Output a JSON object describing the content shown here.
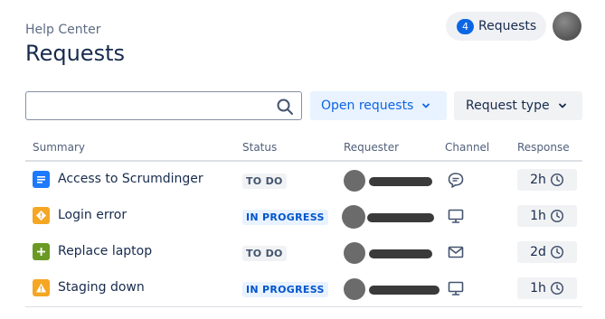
{
  "header": {
    "breadcrumb": "Help Center",
    "title": "Requests",
    "requests_count": "4",
    "requests_label": "Requests"
  },
  "search": {
    "value": "",
    "placeholder": ""
  },
  "filters": {
    "open_requests": "Open requests",
    "request_type": "Request type"
  },
  "table": {
    "columns": [
      "Summary",
      "Status",
      "Requester",
      "Channel",
      "Response"
    ],
    "rows": [
      {
        "summary": "Access to Scrumdinger",
        "status": "TO DO",
        "status_kind": "todo",
        "type_icon": "service-request-icon",
        "type_color": "#1d7afc",
        "channel": "chat-icon",
        "response": "2h"
      },
      {
        "summary": "Login error",
        "status": "IN PROGRESS",
        "status_kind": "progress",
        "type_icon": "incident-icon",
        "type_color": "#f5a623",
        "channel": "monitor-icon",
        "response": "1h"
      },
      {
        "summary": "Replace laptop",
        "status": "TO DO",
        "status_kind": "todo",
        "type_icon": "add-icon",
        "type_color": "#6a9a23",
        "channel": "email-icon",
        "response": "2d"
      },
      {
        "summary": "Staging down",
        "status": "IN PROGRESS",
        "status_kind": "progress",
        "type_icon": "warning-icon",
        "type_color": "#f5a623",
        "channel": "monitor-icon",
        "response": "1h"
      }
    ]
  },
  "colors": {
    "accent": "#0c66e4",
    "text": "#172b4d",
    "subtle": "#505f79"
  }
}
